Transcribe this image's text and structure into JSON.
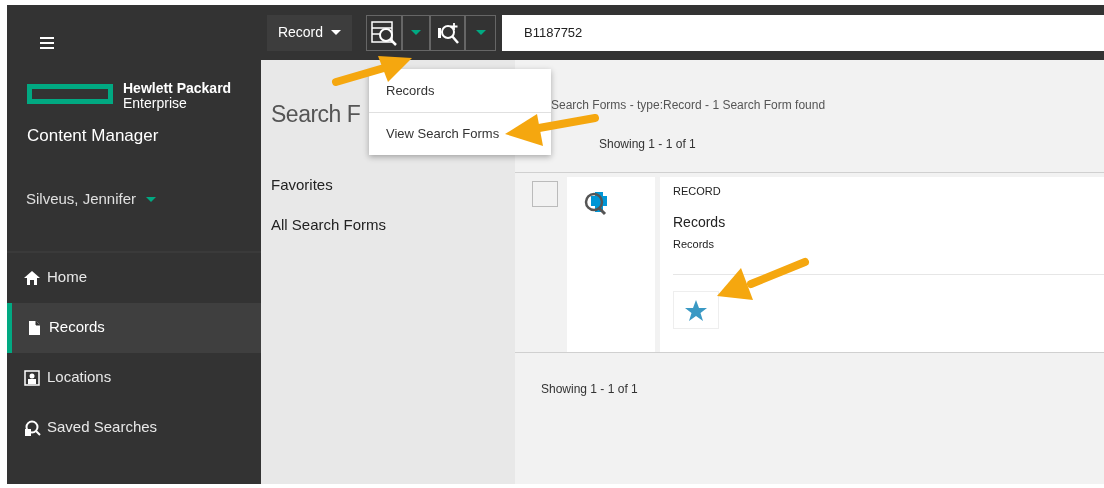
{
  "sidebar": {
    "brand_line_1": "Hewlett Packard",
    "brand_line_2": "Enterprise",
    "app_title": "Content Manager",
    "user": "Silveus, Jennifer",
    "nav_items": [
      {
        "label": "Home",
        "kind": "home",
        "selected": false
      },
      {
        "label": "Records",
        "kind": "document",
        "selected": true
      },
      {
        "label": "Locations",
        "kind": "contact",
        "selected": false
      },
      {
        "label": "Saved Searches",
        "kind": "saved-search",
        "selected": false
      }
    ]
  },
  "toolbar": {
    "type_button": "Record",
    "search_value": "B1187752"
  },
  "dropdown_menu": [
    {
      "label": "Records"
    },
    {
      "label": "View Search Forms"
    }
  ],
  "forms_panel": {
    "heading": "Search F",
    "links": [
      "Favorites",
      "All Search Forms"
    ]
  },
  "results": {
    "summary": "Search Forms - type:Record - 1 Search Form found",
    "showing_top": "Showing 1 - 1 of 1",
    "rows": [
      {
        "type": "RECORD",
        "title": "Records",
        "subtitle": "Records",
        "checked": false,
        "favorite": true
      }
    ],
    "showing_bottom": "Showing 1 - 1 of 1"
  }
}
